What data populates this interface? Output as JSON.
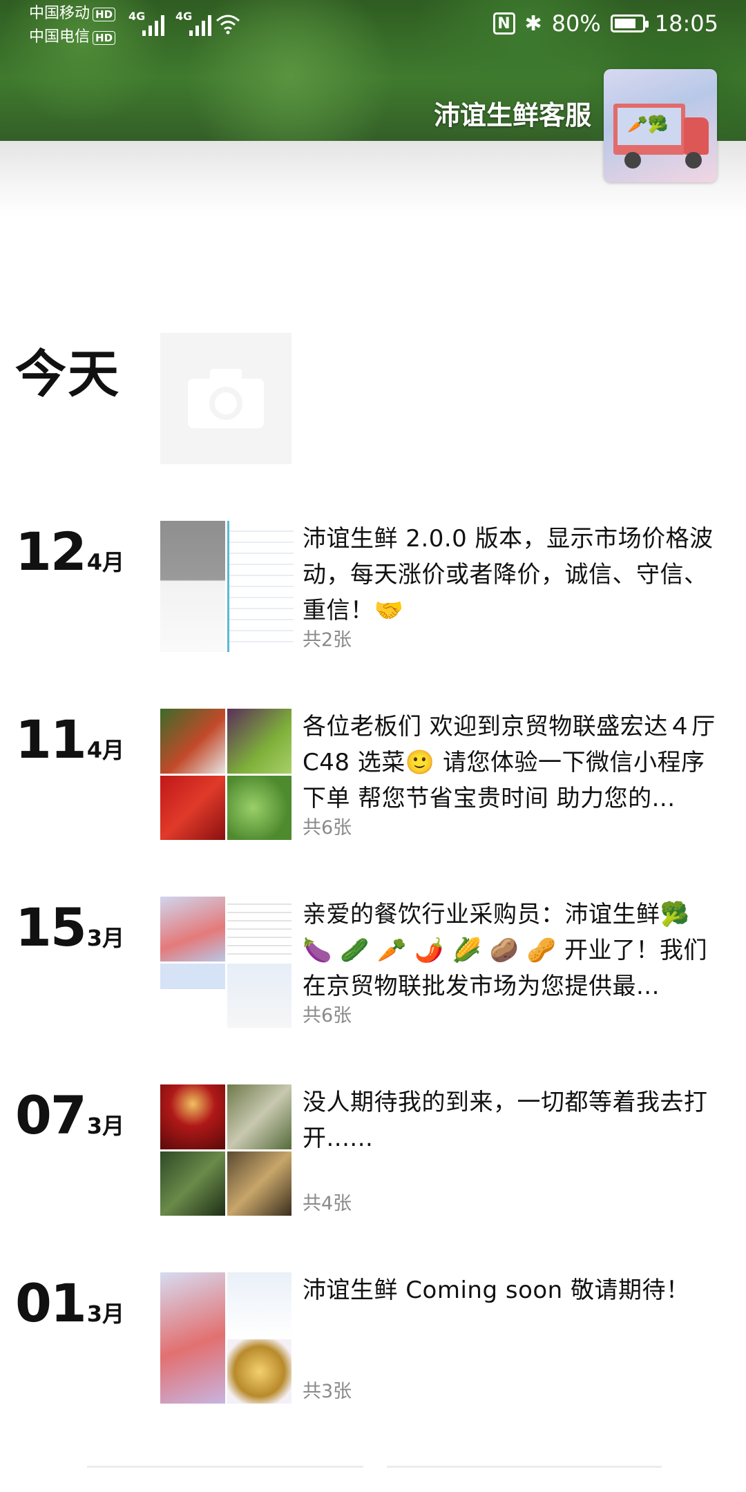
{
  "status_bar": {
    "carrier1": "中国移动",
    "carrier2": "中国电信",
    "hd": "HD",
    "signal1": "4G",
    "signal2": "4G",
    "nfc": "N",
    "bluetooth": "✱",
    "battery": "80%",
    "battery_level": 0.8,
    "time": "18:05"
  },
  "profile": {
    "name": "沛谊生鲜客服"
  },
  "today_label": "今天",
  "posts": [
    {
      "day": "12",
      "month": "4月",
      "text": "沛谊生鲜 2.0.0 版本，显示市场价格波动，每天涨价或者降价，诚信、守信、重信！🤝",
      "count": "共2张"
    },
    {
      "day": "11",
      "month": "4月",
      "text": "各位老板们 欢迎到京贸物联盛宏达４厅C48 选菜🙂 请您体验一下微信小程序下单 帮您节省宝贵时间 助力您的...",
      "count": "共6张"
    },
    {
      "day": "15",
      "month": "3月",
      "text": "亲爱的餐饮行业采购员：沛谊生鲜🥦 🍆 🥒 🥕 🌶️ 🌽 🥔 🥜 开业了！我们在京贸物联批发市场为您提供最...",
      "count": "共6张"
    },
    {
      "day": "07",
      "month": "3月",
      "text": "没人期待我的到来，一切都等着我去打开......",
      "count": "共4张"
    },
    {
      "day": "01",
      "month": "3月",
      "text": "沛谊生鲜 Coming soon 敬请期待！",
      "count": "共3张"
    }
  ]
}
